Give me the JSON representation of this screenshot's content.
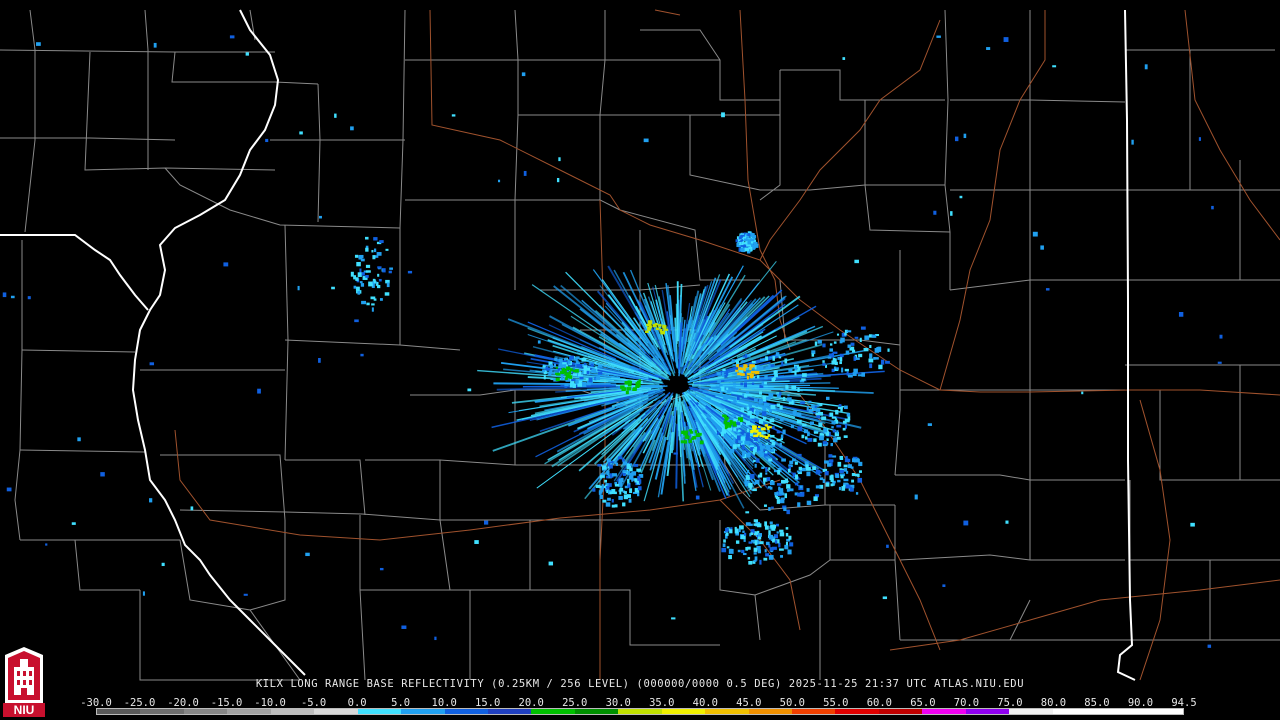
{
  "caption": {
    "text": "KILX LONG RANGE BASE REFLECTIVITY (0.25KM / 256 LEVEL) (000000/0000 0.5 DEG) 2025-11-25 21:37 UTC  ATLAS.NIU.EDU"
  },
  "colorbar": {
    "labels": [
      "-30.0",
      "-25.0",
      "-20.0",
      "-15.0",
      "-10.0",
      "-5.0",
      "0.0",
      "5.0",
      "10.0",
      "15.0",
      "20.0",
      "25.0",
      "30.0",
      "35.0",
      "40.0",
      "45.0",
      "50.0",
      "55.0",
      "60.0",
      "65.0",
      "70.0",
      "75.0",
      "80.0",
      "85.0",
      "90.0",
      "94.5"
    ],
    "colors": [
      "#5a5a5a",
      "#6e6e6e",
      "#868686",
      "#a0a0a0",
      "#bcbcbc",
      "#d8d8d8",
      "#40e0ff",
      "#20a0f0",
      "#1060e0",
      "#2040c0",
      "#00c000",
      "#009000",
      "#c0e000",
      "#f0f000",
      "#f0c000",
      "#f09000",
      "#f04000",
      "#e00000",
      "#c00000",
      "#f000f0",
      "#9000f0",
      "#f0f0f0",
      "#ffffff",
      "#ffffff",
      "#ffffff"
    ]
  },
  "logo": {
    "text": "NIU",
    "primary_color": "#c8102e"
  },
  "map": {
    "background": "#000000",
    "county_color": "#8a8a8a",
    "state_color": "#ffffff",
    "road_color": "#a0522d",
    "radar_site": "KILX"
  }
}
